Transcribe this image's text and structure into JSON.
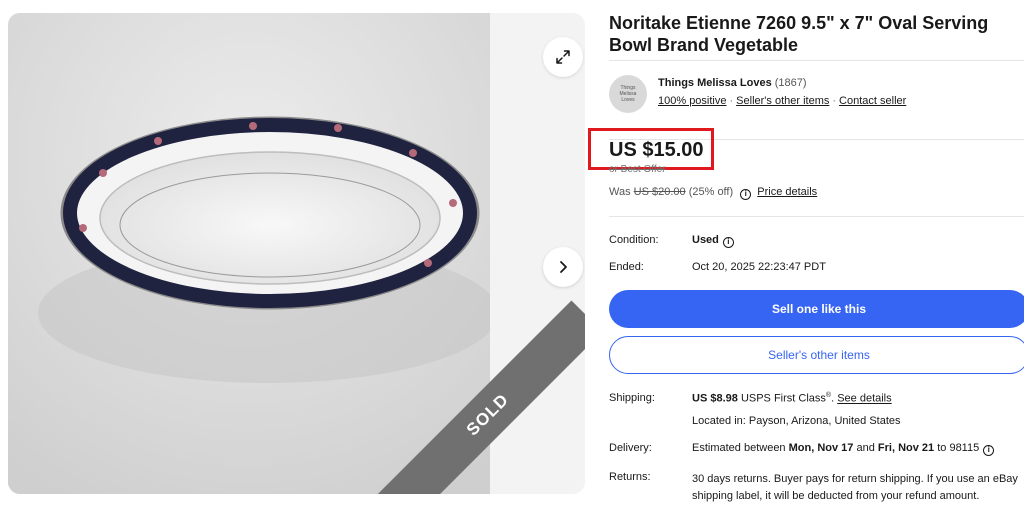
{
  "gallery": {
    "sold_label": "SOLD",
    "expand_icon": "expand-arrows-icon",
    "next_icon": "chevron-right-icon"
  },
  "listing": {
    "title": "Noritake Etienne 7260 9.5\" x 7\" Oval Serving Bowl Brand Vegetable"
  },
  "seller": {
    "avatar_text": "Things Melissa Loves",
    "name": "Things Melissa Loves",
    "feedback_count": "(1867)",
    "positive": "100% positive",
    "other_items": "Seller's other items",
    "contact": "Contact seller"
  },
  "price": {
    "current": "US $15.00",
    "best_offer": "or Best Offer",
    "was_label": "Was",
    "was_price": "US $20.00",
    "discount": "(25% off)",
    "details_link": "Price details"
  },
  "details": {
    "condition_label": "Condition:",
    "condition_value": "Used",
    "ended_label": "Ended:",
    "ended_value": "Oct 20, 2025 22:23:47 PDT"
  },
  "buttons": {
    "sell_one": "Sell one like this",
    "seller_items": "Seller's other items"
  },
  "shipping": {
    "label": "Shipping:",
    "price": "US $8.98",
    "method": "USPS First Class",
    "registered": "®",
    "see_details": "See details",
    "location": "Located in: Payson, Arizona, United States"
  },
  "delivery": {
    "label": "Delivery:",
    "prefix": "Estimated between",
    "start": "Mon, Nov 17",
    "and": "and",
    "end": "Fri, Nov 21",
    "to": "to 98115"
  },
  "returns": {
    "label": "Returns:",
    "text": "30 days returns. Buyer pays for return shipping. If you use an eBay shipping label, it will be deducted from your refund amount."
  },
  "colors": {
    "accent": "#3665f3",
    "highlight_box": "#e0191e",
    "sold_ribbon": "#707070"
  }
}
